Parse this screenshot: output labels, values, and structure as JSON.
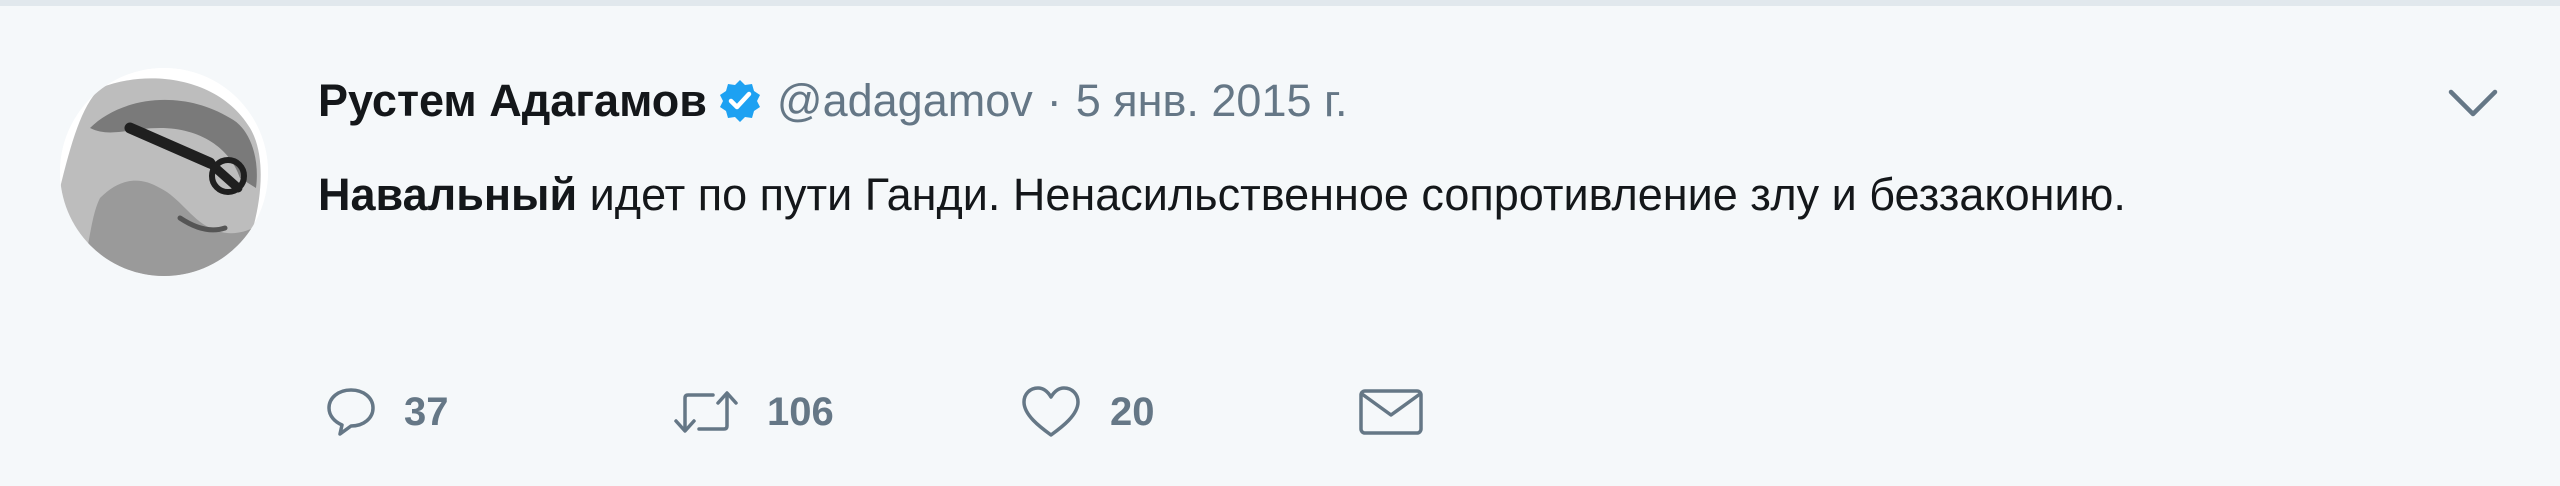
{
  "tweet": {
    "author": {
      "display_name": "Рустем Адагамов",
      "screen_name": "@adagamov",
      "verified": true
    },
    "separator": "·",
    "timestamp": "5 янв. 2015 г.",
    "text": {
      "bold": "Навальный",
      "rest": "идет по пути Ганди. Ненасильственное сопротивление злу и беззаконию."
    },
    "actions": {
      "reply_count": "37",
      "retweet_count": "106",
      "like_count": "20"
    }
  },
  "colors": {
    "background": "#f5f8fa",
    "text_primary": "#14171a",
    "text_secondary": "#657786",
    "verified_blue": "#1da1f2",
    "border": "#e1e8ed"
  },
  "icons": {
    "verified": "verified-badge-icon",
    "caret": "chevron-down-icon",
    "reply": "reply-bubble-icon",
    "retweet": "retweet-arrows-icon",
    "like": "heart-icon",
    "dm": "envelope-icon"
  }
}
